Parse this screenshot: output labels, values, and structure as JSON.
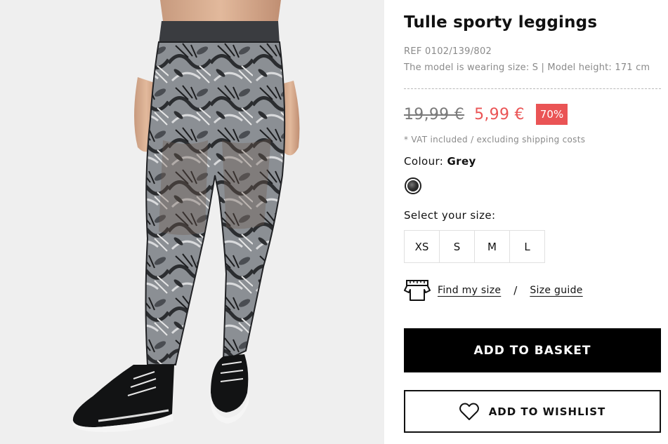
{
  "product": {
    "title": "Tulle sporty leggings",
    "ref": "REF 0102/139/802",
    "model_info": "The model is wearing size: S | Model height: 171 cm"
  },
  "pricing": {
    "old_price": "19,99 €",
    "new_price": "5,99 €",
    "discount": "70%",
    "vat_note": "* VAT included / excluding shipping costs",
    "sale_color": "#ea5455"
  },
  "colour": {
    "label": "Colour:",
    "value": "Grey"
  },
  "sizes": {
    "label": "Select your size:",
    "options": [
      "XS",
      "S",
      "M",
      "L"
    ]
  },
  "fit": {
    "find_my_size": "Find my size",
    "separator": "/",
    "size_guide": "Size guide",
    "icon": "tshirt-ruler-icon"
  },
  "actions": {
    "add_to_basket": "ADD TO BASKET",
    "add_to_wishlist": "ADD TO WISHLIST",
    "wishlist_icon": "heart-outline-icon"
  }
}
